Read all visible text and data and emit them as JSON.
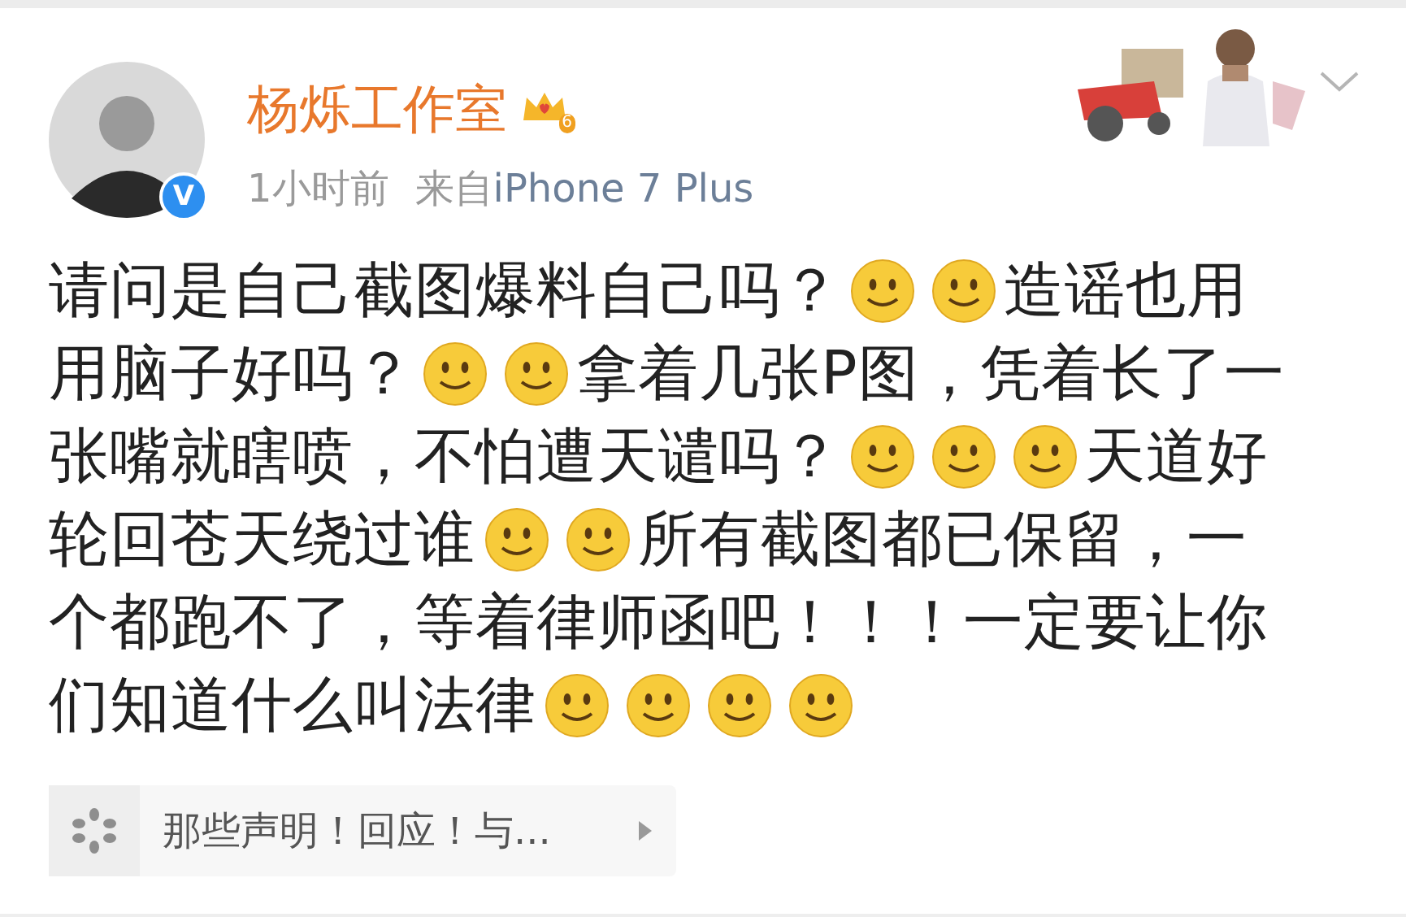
{
  "post": {
    "author": "杨烁工作室",
    "vip_level": "6",
    "verified_mark": "V",
    "time": "1小时前",
    "source_prefix": "来自",
    "source": "iPhone 7 Plus",
    "body_lines": [
      [
        {
          "kind": "text",
          "text": "请问是自己截图爆料自己吗？"
        },
        {
          "kind": "emoji"
        },
        {
          "kind": "emoji"
        },
        {
          "kind": "text",
          "text": "造谣也用"
        }
      ],
      [
        {
          "kind": "text",
          "text": "用脑子好吗？"
        },
        {
          "kind": "emoji"
        },
        {
          "kind": "emoji"
        },
        {
          "kind": "text",
          "text": "拿着几张P图，凭着长了一"
        }
      ],
      [
        {
          "kind": "text",
          "text": "张嘴就瞎喷，不怕遭天谴吗？"
        },
        {
          "kind": "emoji"
        },
        {
          "kind": "emoji"
        },
        {
          "kind": "emoji"
        },
        {
          "kind": "text",
          "text": "天道好"
        }
      ],
      [
        {
          "kind": "text",
          "text": "轮回苍天绕过谁"
        },
        {
          "kind": "emoji"
        },
        {
          "kind": "emoji"
        },
        {
          "kind": "text",
          "text": "所有截图都已保留，一"
        }
      ],
      [
        {
          "kind": "text",
          "text": "个都跑不了，等着律师函吧！！！一定要让你"
        }
      ],
      [
        {
          "kind": "text",
          "text": "们知道什么叫法律"
        },
        {
          "kind": "emoji"
        },
        {
          "kind": "emoji"
        },
        {
          "kind": "emoji"
        },
        {
          "kind": "emoji"
        }
      ]
    ],
    "topic_card": {
      "title": "那些声明！回应！与..."
    }
  }
}
